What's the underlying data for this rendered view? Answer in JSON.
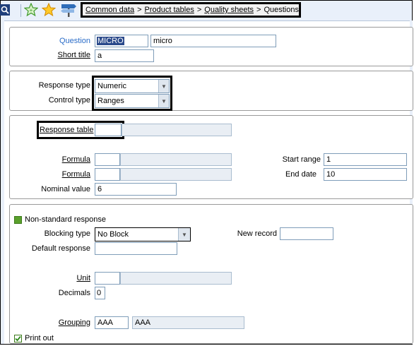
{
  "toolbar": {
    "icons": [
      "search-icon",
      "favorite-add-icon",
      "favorite-star-icon",
      "signpost-icon"
    ],
    "breadcrumb": {
      "items": [
        "Common data",
        "Product tables",
        "Quality sheets",
        "Questions"
      ],
      "separator": ">"
    }
  },
  "header_panel": {
    "question_label": "Question",
    "question_code": "MICRO",
    "question_desc": "micro",
    "short_title_label": "Short title",
    "short_title_value": "a"
  },
  "type_panel": {
    "response_type_label": "Response type",
    "response_type_value": "Numeric",
    "control_type_label": "Control type",
    "control_type_value": "Ranges"
  },
  "range_panel": {
    "response_table_label": "Response table",
    "response_table_value": "",
    "formula1_label": "Formula",
    "formula2_label": "Formula",
    "nominal_value_label": "Nominal value",
    "nominal_value": "6",
    "start_range_label": "Start range",
    "start_range_value": "1",
    "end_date_label": "End date",
    "end_date_value": "10"
  },
  "options_panel": {
    "non_standard_label": "Non-standard response",
    "blocking_type_label": "Blocking type",
    "blocking_type_value": "No Block",
    "new_record_label": "New record",
    "default_response_label": "Default response",
    "unit_label": "Unit",
    "decimals_label": "Decimals",
    "decimals_value": "0",
    "grouping_label": "Grouping",
    "grouping_code": "AAA",
    "grouping_desc": "AAA",
    "print_out_label": "Print out",
    "print_out_checked": true
  },
  "colors": {
    "accent_blue": "#2a6cc8",
    "toolbar_bg": "#e9f0fa",
    "checkbox_green": "#5aa02c"
  }
}
